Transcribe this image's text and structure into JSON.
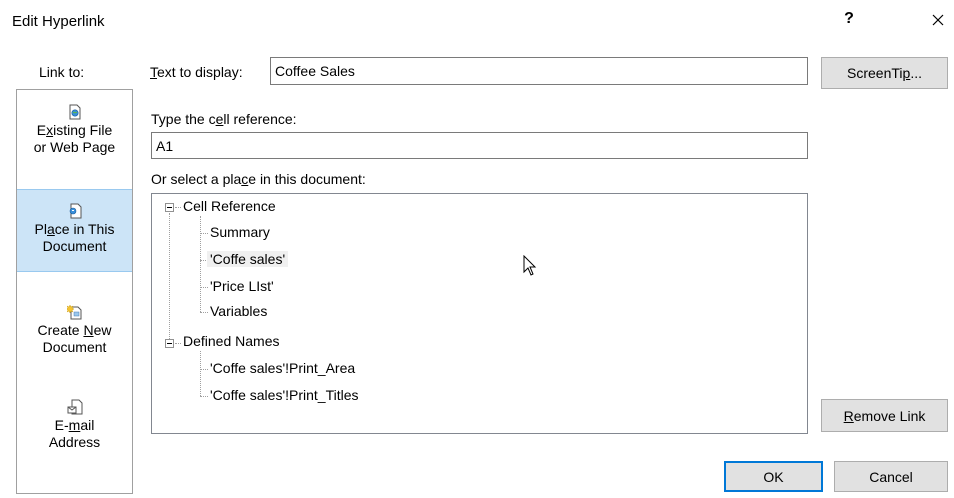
{
  "dialog": {
    "title": "Edit Hyperlink",
    "help": "?",
    "close_icon": "close-icon"
  },
  "sidebar": {
    "label": "Link to:",
    "items": [
      {
        "line1_pre": "",
        "line1_u": "x",
        "line1_post": "isting File",
        "line1_first": "E",
        "line2": "or Web Page",
        "icon": "document-globe-icon",
        "selected": false
      },
      {
        "line1_pre": "Pl",
        "line1_u": "a",
        "line1_post": "ce in This",
        "line2": "Document",
        "icon": "document-place-icon",
        "selected": true
      },
      {
        "line1": "Create ",
        "line1_u": "N",
        "line1_post": "ew",
        "line2": "Document",
        "icon": "new-document-icon",
        "selected": false
      },
      {
        "line1": "E-",
        "line1_u": "m",
        "line1_post": "ail",
        "line2": "Address",
        "icon": "email-icon",
        "selected": false
      }
    ]
  },
  "display": {
    "label_u": "T",
    "label_rest": "ext to display:",
    "value": "Coffee Sales"
  },
  "cellref": {
    "label_pre": "Type the c",
    "label_u": "e",
    "label_post": "ll reference:",
    "value": "A1"
  },
  "place": {
    "label_pre": "Or select a pla",
    "label_u": "c",
    "label_post": "e in this document:"
  },
  "tree": {
    "groups": [
      {
        "label": "Cell Reference",
        "children": [
          "Summary",
          "'Coffe sales'",
          "'Price LIst'",
          "Variables"
        ]
      },
      {
        "label": "Defined Names",
        "children": [
          "'Coffe sales'!Print_Area",
          "'Coffe sales'!Print_Titles"
        ]
      }
    ],
    "selected": "'Coffe sales'"
  },
  "buttons": {
    "screentip_pre": "ScreenTi",
    "screentip_u": "p",
    "screentip_post": "...",
    "remove_u": "R",
    "remove_rest": "emove Link",
    "ok": "OK",
    "cancel": "Cancel"
  }
}
